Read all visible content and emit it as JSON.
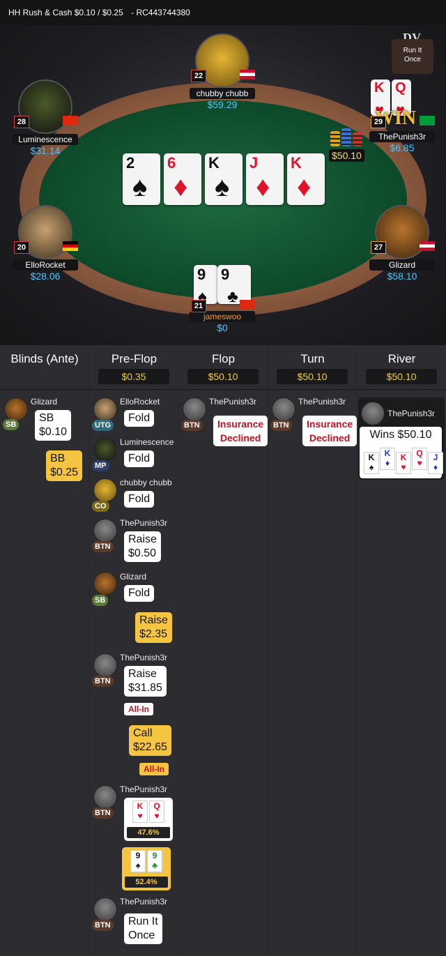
{
  "header": {
    "title": "HH  Rush & Cash $0.10 / $0.25",
    "hand_id": "- RC443744380"
  },
  "brand": "DV",
  "run_it_once_badge": {
    "line1": "Run It",
    "line2": "Once"
  },
  "board_cards": [
    {
      "rank": "2",
      "suit": "♠",
      "color": "black"
    },
    {
      "rank": "6",
      "suit": "♦",
      "color": "red"
    },
    {
      "rank": "K",
      "suit": "♠",
      "color": "black"
    },
    {
      "rank": "J",
      "suit": "♦",
      "color": "red"
    },
    {
      "rank": "K",
      "suit": "♦",
      "color": "red"
    }
  ],
  "pot_chip_label": "$50.10",
  "win_label": "WIN",
  "seats": {
    "top": {
      "name": "chubby chubb",
      "stack": "$59.29",
      "level": "22"
    },
    "top_left": {
      "name": "Luminescence",
      "stack": "$31.14",
      "level": "28"
    },
    "top_right": {
      "name": "ThePunish3r",
      "stack": "$6.85",
      "level": "29",
      "cards": [
        {
          "rank": "K",
          "suit": "♥"
        },
        {
          "rank": "Q",
          "suit": "♥"
        }
      ]
    },
    "mid_left": {
      "name": "ElloRocket",
      "stack": "$28.06",
      "level": "20"
    },
    "mid_right": {
      "name": "Glizard",
      "stack": "$58.10",
      "level": "27"
    },
    "hero": {
      "name": "jameswoo",
      "stack": "$0",
      "level": "21",
      "cards": [
        {
          "rank": "9",
          "suit": "♠"
        },
        {
          "rank": "9",
          "suit": "♣"
        }
      ]
    }
  },
  "streets": {
    "blinds": {
      "label": "Blinds (Ante)"
    },
    "preflop": {
      "label": "Pre-Flop",
      "pot": "$0.35"
    },
    "flop": {
      "label": "Flop",
      "pot": "$50.10"
    },
    "turn": {
      "label": "Turn",
      "pot": "$50.10"
    },
    "river": {
      "label": "River",
      "pot": "$50.10"
    }
  },
  "blinds_actions": {
    "sb": {
      "player": "Glizard",
      "pos": "SB",
      "l1": "SB",
      "l2": "$0.10"
    },
    "bb": {
      "l1": "BB",
      "l2": "$0.25"
    }
  },
  "preflop_actions": [
    {
      "player": "ElloRocket",
      "pos": "UTG",
      "l1": "Fold"
    },
    {
      "player": "Luminescence",
      "pos": "MP",
      "l1": "Fold"
    },
    {
      "player": "chubby chubb",
      "pos": "CO",
      "l1": "Fold"
    },
    {
      "player": "ThePunish3r",
      "pos": "BTN",
      "l1": "Raise",
      "l2": "$0.50"
    },
    {
      "player": "Glizard",
      "pos": "SB",
      "l1": "Fold"
    },
    {
      "l1": "Raise",
      "l2": "$2.35"
    },
    {
      "player": "ThePunish3r",
      "pos": "BTN",
      "l1": "Raise",
      "l2": "$31.85",
      "tag": "All-In"
    },
    {
      "l1": "Call",
      "l2": "$22.65",
      "tag": "All-In"
    },
    {
      "player": "ThePunish3r",
      "pos": "BTN",
      "equity": "47.6%"
    },
    {
      "equity": "52.4%"
    },
    {
      "player": "ThePunish3r",
      "pos": "BTN",
      "l1": "Run It",
      "l2": "Once"
    }
  ],
  "flop_action": {
    "player": "ThePunish3r",
    "pos": "BTN",
    "l1": "Insurance",
    "l2": "Declined"
  },
  "turn_action": {
    "player": "ThePunish3r",
    "pos": "BTN",
    "l1": "Insurance",
    "l2": "Declined"
  },
  "river_action": {
    "player": "ThePunish3r",
    "result": "Wins $50.10",
    "cards": [
      {
        "rank": "K",
        "suit": "♠"
      },
      {
        "rank": "K",
        "suit": "♦"
      },
      {
        "rank": "K",
        "suit": "♥"
      },
      {
        "rank": "Q",
        "suit": "♥"
      },
      {
        "rank": "J",
        "suit": "♦"
      }
    ]
  },
  "colors": {
    "felt": "#0d4a2a",
    "rail": "#8a5a3f",
    "stack": "#4fc3ff",
    "pot": "#f0c94a",
    "bubble_yellow": "#f5c542"
  }
}
